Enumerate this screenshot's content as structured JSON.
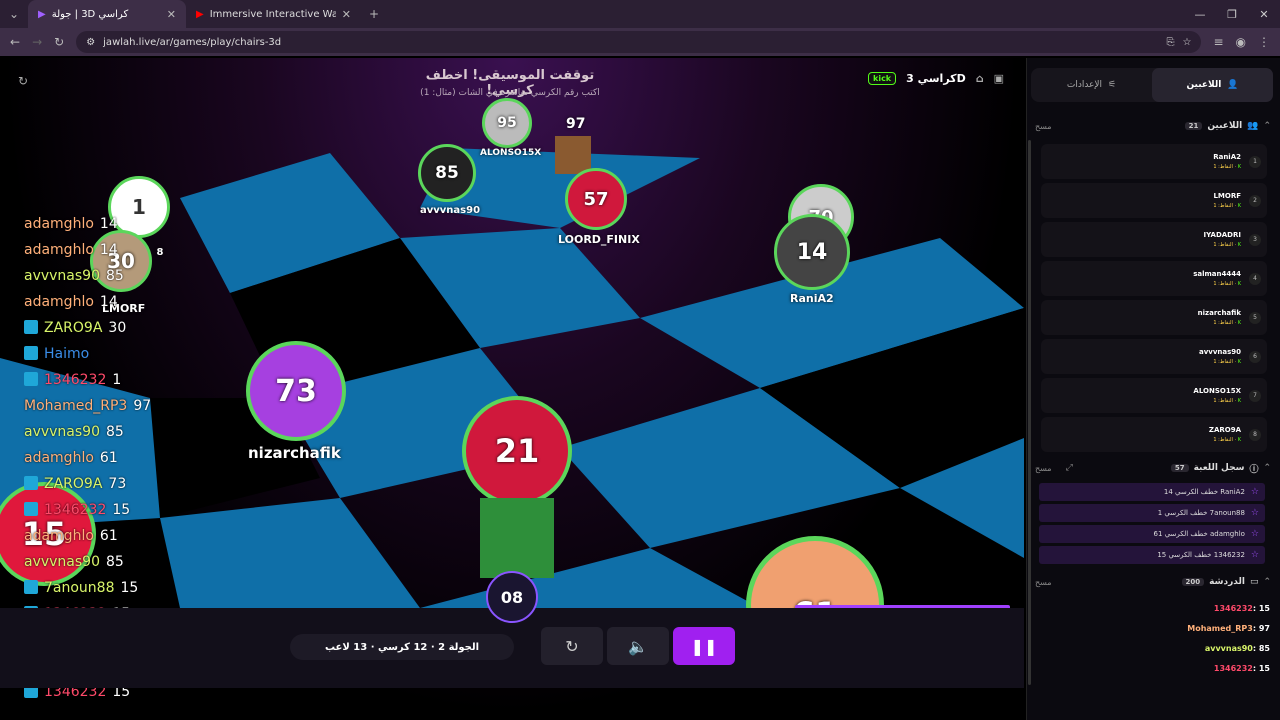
{
  "browser": {
    "tabs": [
      {
        "title": "كراسي 3D | جولة",
        "active": true
      },
      {
        "title": "Immersive Interactive Warm Up",
        "active": false
      }
    ],
    "url": "jawlah.live/ar/games/play/chairs-3d"
  },
  "hud": {
    "title": "توقفت الموسيقى! اخطف كرسي!",
    "subtitle": "اكتب رقم الكرسي مباشرة في الشات (مثال: 1)",
    "game_name": "كراسي 3D",
    "platform": "kick"
  },
  "chairs": [
    {
      "number": "1",
      "name": ""
    },
    {
      "number": "30",
      "name": "LMORF"
    },
    {
      "number": "85",
      "name": "avvvnas90"
    },
    {
      "number": "95",
      "name": "ALONSO15X"
    },
    {
      "number": "97",
      "name": ""
    },
    {
      "number": "57",
      "name": "LOORD_FINIX"
    },
    {
      "number": "70",
      "name": ""
    },
    {
      "number": "14",
      "name": "RaniA2"
    },
    {
      "number": "73",
      "name": "nizarchafik"
    },
    {
      "number": "21",
      "name": ""
    },
    {
      "number": "15",
      "name": ""
    },
    {
      "number": "61",
      "name": ""
    },
    {
      "number": "8",
      "name": ""
    }
  ],
  "overlay_chat": [
    {
      "name": "adamghlo",
      "value": "14",
      "color": "#ffb07a",
      "badge": false
    },
    {
      "name": "adamghlo",
      "value": "14",
      "color": "#ffb07a",
      "badge": false
    },
    {
      "name": "avvvnas90",
      "value": "85",
      "color": "#d9f56a",
      "badge": false
    },
    {
      "name": "adamghlo",
      "value": "14",
      "color": "#ffb07a",
      "badge": false
    },
    {
      "name": "ZARO9A",
      "value": "30",
      "color": "#d9f56a",
      "badge": true
    },
    {
      "name": "Haimo",
      "value": "",
      "color": "#3a8de8",
      "badge": true
    },
    {
      "name": "1346232",
      "value": "1",
      "color": "#ff4a6a",
      "badge": true
    },
    {
      "name": "Mohamed_RP3",
      "value": "97",
      "color": "#ffb07a",
      "badge": false
    },
    {
      "name": "avvvnas90",
      "value": "85",
      "color": "#d9f56a",
      "badge": false
    },
    {
      "name": "adamghlo",
      "value": "61",
      "color": "#ffb07a",
      "badge": false
    },
    {
      "name": "ZARO9A",
      "value": "73",
      "color": "#d9f56a",
      "badge": true
    },
    {
      "name": "1346232",
      "value": "15",
      "color": "#ff4a6a",
      "badge": true
    },
    {
      "name": "adamghlo",
      "value": "61",
      "color": "#ffb07a",
      "badge": false
    },
    {
      "name": "avvvnas90",
      "value": "85",
      "color": "#d9f56a",
      "badge": false
    },
    {
      "name": "7anoun88",
      "value": "15",
      "color": "#d9f56a",
      "badge": true
    },
    {
      "name": "1346232",
      "value": "15",
      "color": "#ff4a6a",
      "badge": true
    },
    {
      "name": "Mohamed_RP3",
      "value": "97",
      "color": "#ffb07a",
      "badge": false
    },
    {
      "name": "avvvnas90",
      "value": "85",
      "color": "#d9f56a",
      "badge": false
    },
    {
      "name": "1346232",
      "value": "15",
      "color": "#ff4a6a",
      "badge": true
    }
  ],
  "controls": {
    "timer": "08",
    "round_info": "الجولة 2 · 12 كرسي · 13 لاعب"
  },
  "panel": {
    "tab_players": "اللاعبين",
    "tab_settings": "الإعدادات",
    "players_section": {
      "title": "اللاعبين",
      "count": "21",
      "clear": "مسح"
    },
    "players": [
      {
        "rank": "1",
        "name": "RaniA2",
        "points": "النقاط: 1"
      },
      {
        "rank": "2",
        "name": "LMORF",
        "points": "النقاط: 1"
      },
      {
        "rank": "3",
        "name": "IYADADRI",
        "points": "النقاط: 1"
      },
      {
        "rank": "4",
        "name": "salman4444",
        "points": "النقاط: 1"
      },
      {
        "rank": "5",
        "name": "nizarchafik",
        "points": "النقاط: 1"
      },
      {
        "rank": "6",
        "name": "avvvnas90",
        "points": "النقاط: 1"
      },
      {
        "rank": "7",
        "name": "ALONSO15X",
        "points": "النقاط: 1"
      },
      {
        "rank": "8",
        "name": "ZARO9A",
        "points": "النقاط: 1"
      }
    ],
    "log_section": {
      "title": "سجل اللعبة",
      "count": "57",
      "clear": "مسح"
    },
    "log": [
      "RaniA2 خطف الكرسي 14",
      "7anoun88 خطف الكرسي 1",
      "adamghlo خطف الكرسي 61",
      "1346232 خطف الكرسي 15"
    ],
    "chat_section": {
      "title": "الدردشة",
      "count": "200",
      "clear": "مسح"
    },
    "chat": [
      {
        "name": "1346232",
        "value": "15",
        "color": "#ff4a6a"
      },
      {
        "name": "Mohamed_RP3",
        "value": "97",
        "color": "#ffb07a"
      },
      {
        "name": "avvvnas90",
        "value": "85",
        "color": "#d9f56a"
      },
      {
        "name": "1346232",
        "value": "15",
        "color": "#ff4a6a"
      }
    ]
  }
}
